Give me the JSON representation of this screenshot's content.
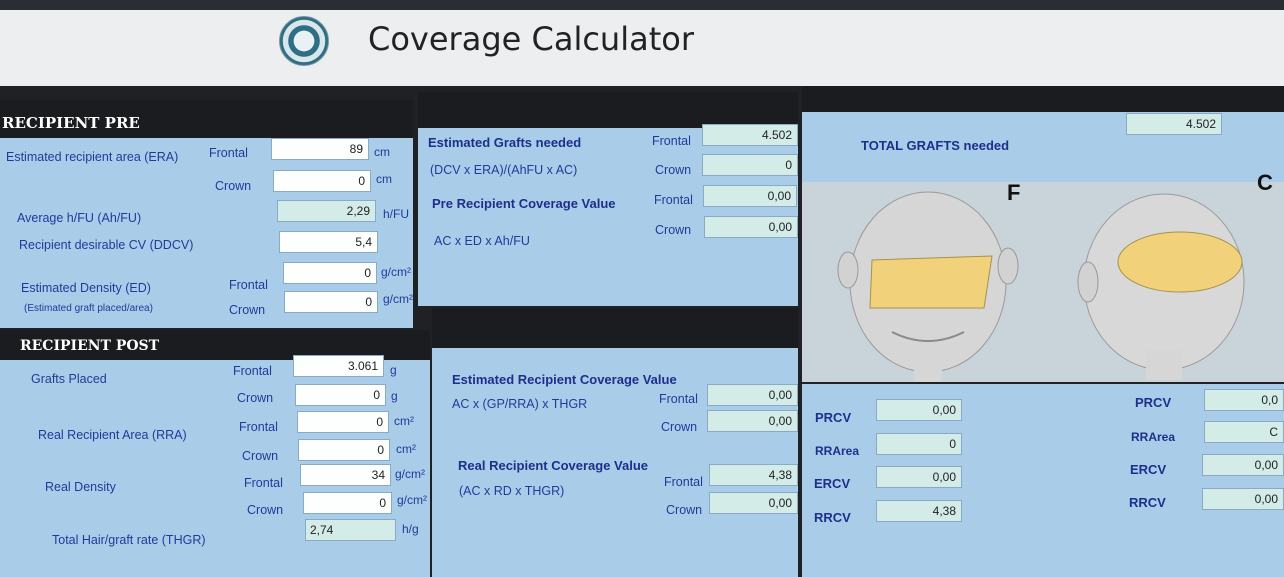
{
  "app": {
    "title": "Coverage Calculator"
  },
  "recipient_pre": {
    "header": "RECIPIENT PRE",
    "era_label": "Estimated recipient area (ERA)",
    "frontal_label": "Frontal",
    "crown_label": "Crown",
    "era_frontal": "89",
    "era_crown": "0",
    "unit_cm": "cm",
    "ahfu_label": "Average h/FU (Ah/FU)",
    "ahfu_value": "2,29",
    "unit_hfu": "h/FU",
    "ddcv_label": "Recipient desirable CV (DDCV)",
    "ddcv_value": "5,4",
    "ed_label": "Estimated Density (ED)",
    "ed_sub": "(Estimated graft placed/area)",
    "ed_frontal": "0",
    "ed_crown": "0",
    "unit_gcm": "g/cm²"
  },
  "grafts_needed": {
    "label": "Estimated Grafts needed",
    "formula": "(DCV x ERA)/(AhFU x AC)",
    "frontal_label": "Frontal",
    "crown_label": "Crown",
    "frontal": "4.502",
    "crown": "0",
    "pre_cov_label": "Pre Recipient Coverage Value",
    "pre_cov_formula": "AC x ED x Ah/FU",
    "pre_frontal": "0,00",
    "pre_crown": "0,00"
  },
  "total": {
    "label": "TOTAL GRAFTS needed",
    "value": "4.502"
  },
  "heads": {
    "front_letter": "F",
    "crown_letter": "C"
  },
  "recipient_post": {
    "header": "RECIPIENT POST",
    "grafts_label": "Grafts Placed",
    "frontal_label": "Frontal",
    "crown_label": "Crown",
    "grafts_frontal": "3.061",
    "grafts_crown": "0",
    "unit_g": "g",
    "rra_label": "Real Recipient Area (RRA)",
    "rra_frontal": "0",
    "rra_crown": "0",
    "unit_cm2": "cm²",
    "rd_label": "Real Density",
    "rd_frontal": "34",
    "rd_crown": "0",
    "unit_gcm": "g/cm²",
    "thgr_label": "Total Hair/graft rate (THGR)",
    "thgr_value": "2,74",
    "unit_hg": "h/g"
  },
  "post_values": {
    "erc_label": "Estimated Recipient Coverage Value",
    "erc_formula": "AC x (GP/RRA) x THGR",
    "frontal_label": "Frontal",
    "crown_label": "Crown",
    "erc_frontal": "0,00",
    "erc_crown": "0,00",
    "rrc_label": "Real Recipient Coverage Value",
    "rrc_formula": "(AC x RD x THGR)",
    "rrc_frontal": "4,38",
    "rrc_crown": "0,00"
  },
  "summary_left": {
    "prcv_label": "PRCV",
    "prcv": "0,00",
    "rrarea_label": "RRArea",
    "rrarea": "0",
    "ercv_label": "ERCV",
    "ercv": "0,00",
    "rrcv_label": "RRCV",
    "rrcv": "4,38"
  },
  "summary_right": {
    "prcv_label": "PRCV",
    "prcv": "0,0",
    "rrarea_label": "RRArea",
    "rrarea": "C",
    "ercv_label": "ERCV",
    "ercv": "0,00",
    "rrcv_label": "RRCV",
    "rrcv": "0,00"
  }
}
